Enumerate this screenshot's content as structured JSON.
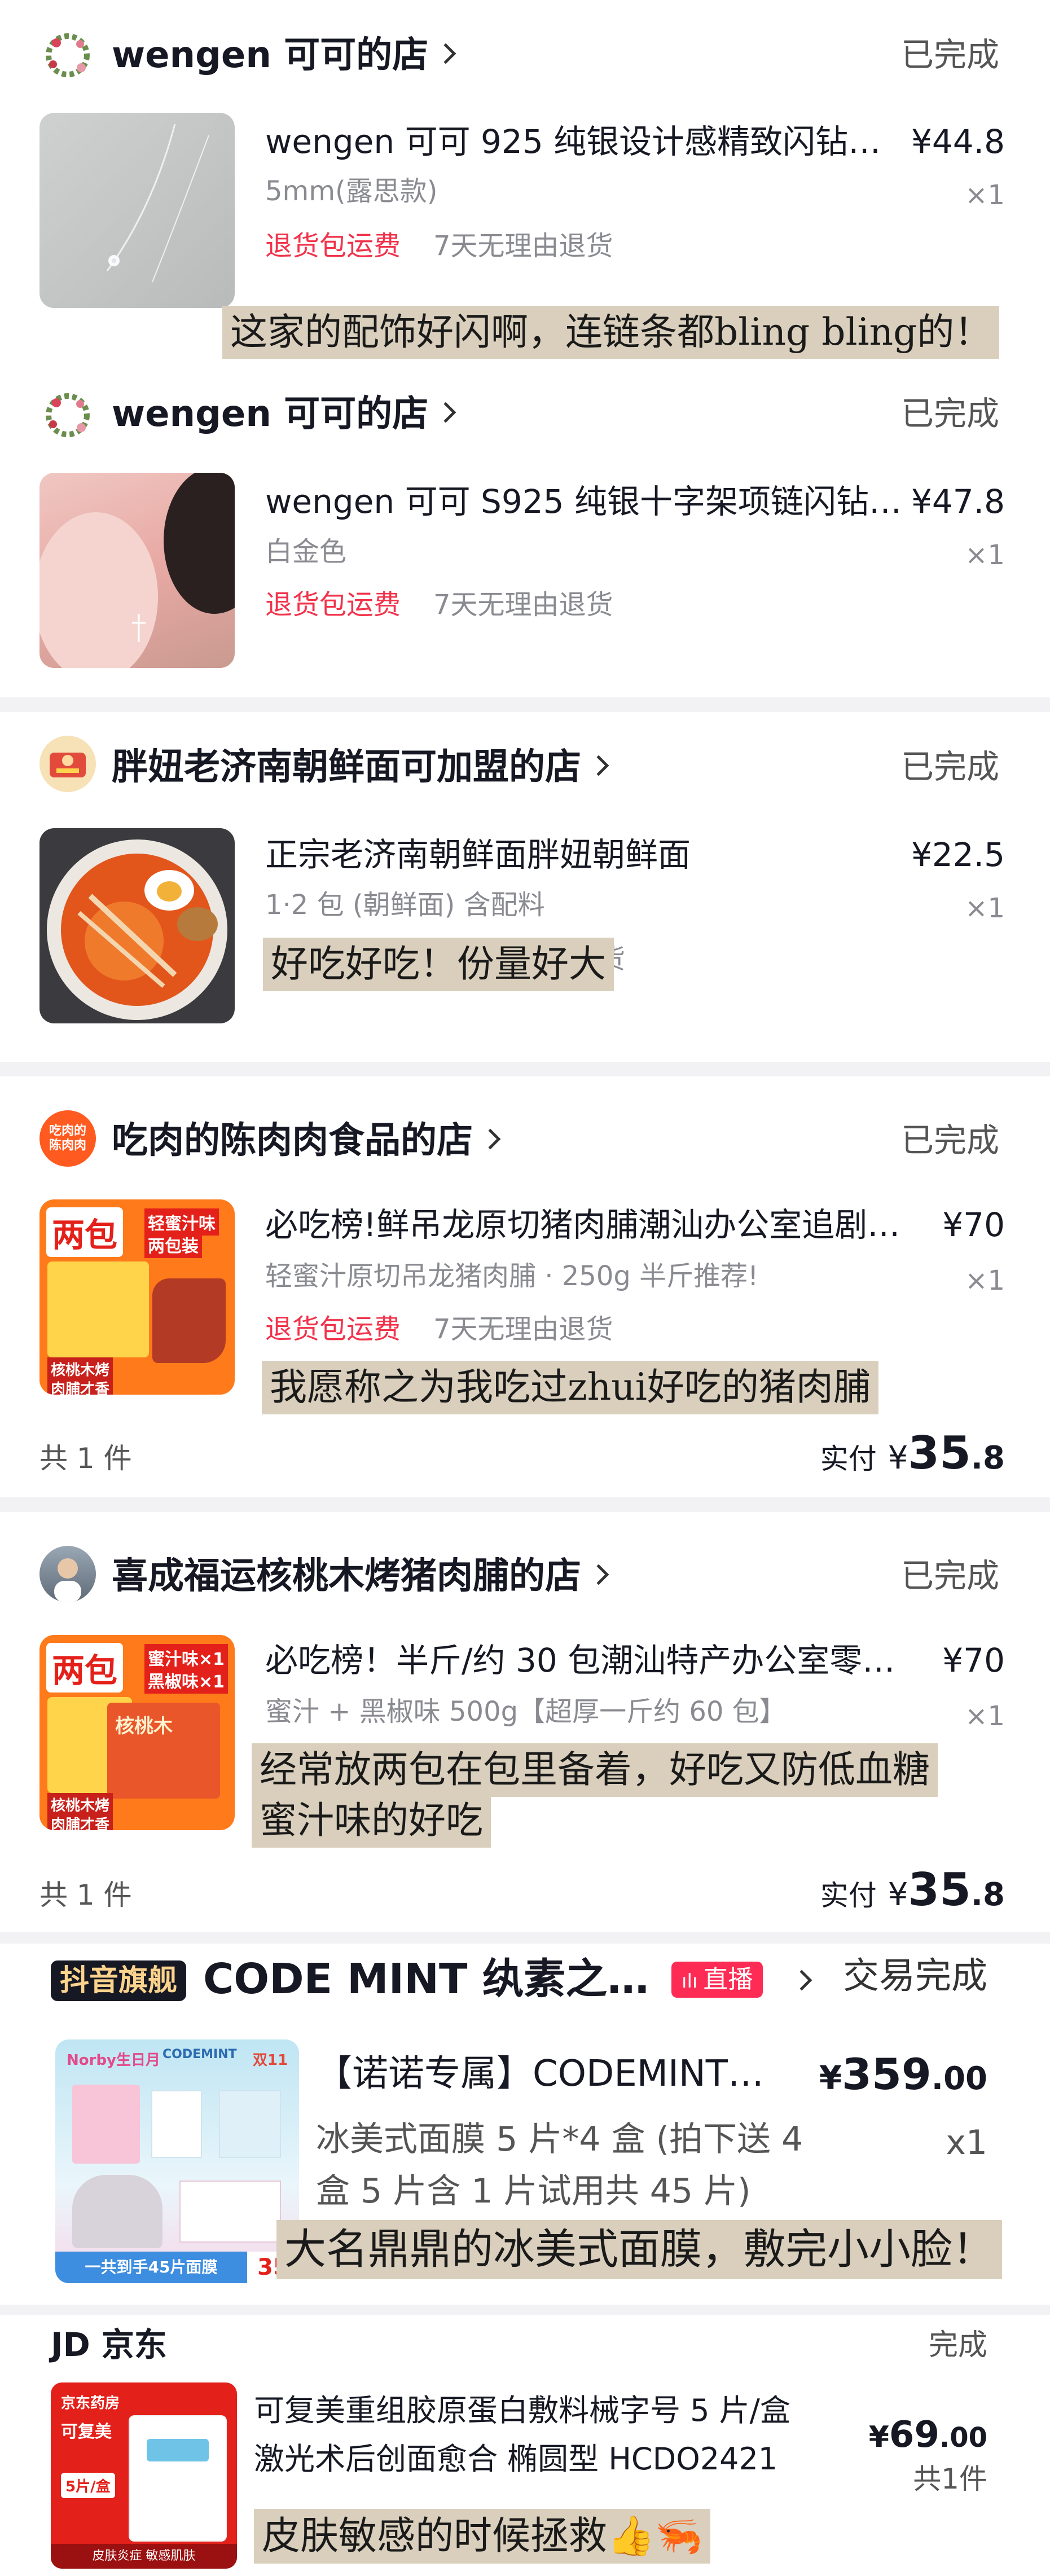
{
  "orders": [
    {
      "shop": "wengen 可可的店",
      "status": "已完成",
      "title": "wengen 可可 925 纯银设计感精致闪钻…",
      "price": "¥44.8",
      "spec": "5mm(露思款)",
      "qty": "×1",
      "tag_red": "退货包运费",
      "tag_gray": "7天无理由退货",
      "note": "这家的配饰好闪啊，连链条都bling bling的！"
    },
    {
      "shop": "wengen 可可的店",
      "status": "已完成",
      "title": "wengen 可可 S925 纯银十字架项链闪钻…",
      "price": "¥47.8",
      "spec": "白金色",
      "qty": "×1",
      "tag_red": "退货包运费",
      "tag_gray": "7天无理由退货"
    },
    {
      "shop": "胖妞老济南朝鲜面可加盟的店",
      "status": "已完成",
      "title": "正宗老济南朝鲜面胖妞朝鲜面",
      "price": "¥22.5",
      "spec": "1·2 包 (朝鲜面) 含配料",
      "qty": "×1",
      "tag_hidden": "货",
      "note": "好吃好吃！份量好大"
    },
    {
      "shop": "吃肉的陈肉肉食品的店",
      "shop_logo": "吃肉的陈肉肉",
      "status": "已完成",
      "title": "必吃榜!鲜吊龙原切猪肉脯潮汕办公室追剧…",
      "price": "¥70",
      "spec": "轻蜜汁原切吊龙猪肉脯 · 250g 半斤推荐!",
      "qty": "×1",
      "tag_red": "退货包运费",
      "tag_gray": "7天无理由退货",
      "note": "我愿称之为我吃过zhui好吃的猪肉脯",
      "count": "共 1 件",
      "paid_label": "实付",
      "paid_yen": "¥",
      "paid_int": "35",
      "paid_dec": ".8",
      "thumb_text": {
        "a": "两包",
        "b": "轻蜜汁味",
        "c": "两包装",
        "d": "核桃木烤",
        "e": "肉脯才香"
      }
    },
    {
      "shop": "喜成福运核桃木烤猪肉脯的店",
      "status": "已完成",
      "title": "必吃榜！半斤/约 30 包潮汕特产办公室零…",
      "price": "¥70",
      "spec": "蜜汁 + 黑椒味 500g【超厚一斤约 60 包】",
      "qty": "×1",
      "note1": "经常放两包在包里备着，好吃又防低血糖",
      "note2": "蜜汁味的好吃",
      "count": "共 1 件",
      "paid_label": "实付",
      "paid_yen": "¥",
      "paid_int": "35",
      "paid_dec": ".8",
      "thumb_text": {
        "a": "两包",
        "b": "蜜汁味×1",
        "c": "黑椒味×1",
        "d": "核桃木烤",
        "e": "肉脯才香",
        "f": "核桃木"
      }
    }
  ],
  "mint": {
    "brand_tag": "抖音旗舰",
    "shop": "CODE MINT 纨素之…",
    "live": "直播",
    "status": "交易完成",
    "title": "【诺诺专属】CODEMINT…",
    "price_yen": "¥",
    "price_int": "359",
    "price_dec": ".00",
    "spec1": "冰美式面膜 5 片*4 盒 (拍下送 4",
    "spec2": "盒 5 片含 1 片试用共 45 片)",
    "qty": "x1",
    "note": "大名鼎鼎的冰美式面膜，敷完小小脸！",
    "thumb_text": {
      "a": "Norby生日月",
      "b": "CODEMINT",
      "c": "双11",
      "d": "一共到手45片面膜",
      "e": "35"
    }
  },
  "jd": {
    "logo": "JD 京东",
    "status": "完成",
    "title1": "可复美重组胶原蛋白敷料械字号 5 片/盒",
    "title2": "激光术后创面愈合 椭圆型 HCDO2421",
    "price_yen": "¥",
    "price_int": "69",
    "price_dec": ".00",
    "count": "共1件",
    "note": "皮肤敏感的时候拯救👍🦐",
    "thumb_text": {
      "a": "京东药房",
      "b": "可复美",
      "c": "5片/盒",
      "d": "皮肤炎症 敏感肌肤"
    }
  },
  "colors": {
    "red": "#f1334b",
    "gray": "#8a8b91",
    "note_bg": "#d9cfbc",
    "separator": "#f2f2f4"
  }
}
